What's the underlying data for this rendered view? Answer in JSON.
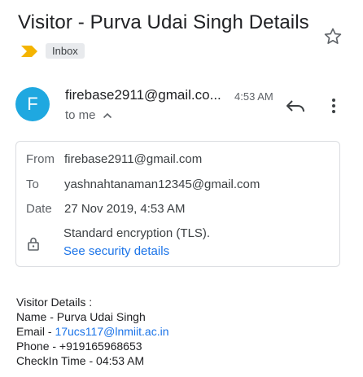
{
  "email": {
    "subject": "Visitor - Purva Udai Singh Details",
    "label": "Inbox",
    "avatar_letter": "F",
    "sender": "firebase2911@gmail.co...",
    "time": "4:53 AM",
    "to_me": "to me"
  },
  "details": {
    "from_label": "From",
    "from_value": "firebase2911@gmail.com",
    "to_label": "To",
    "to_value": "yashnahtanaman12345@gmail.com",
    "date_label": "Date",
    "date_value": "27 Nov 2019, 4:53 AM",
    "encryption": "Standard encryption (TLS).",
    "security_link": "See security details"
  },
  "body": {
    "heading": "Visitor Details :",
    "name_line": "Name - Purva Udai Singh",
    "email_prefix": "Email - ",
    "email_link": "17ucs117@lnmiit.ac.in",
    "phone_line": "Phone - +919165968653",
    "checkin_line": "CheckIn Time - 04:53 AM"
  },
  "icons": [
    "star-icon",
    "importance-marker-icon",
    "reply-icon",
    "more-vert-icon",
    "chevron-up-icon",
    "lock-icon"
  ],
  "colors": {
    "avatar": "#1fa8e0",
    "importance": "#f4b400",
    "link": "#1a73e8",
    "chip_bg": "#e8eaed"
  }
}
